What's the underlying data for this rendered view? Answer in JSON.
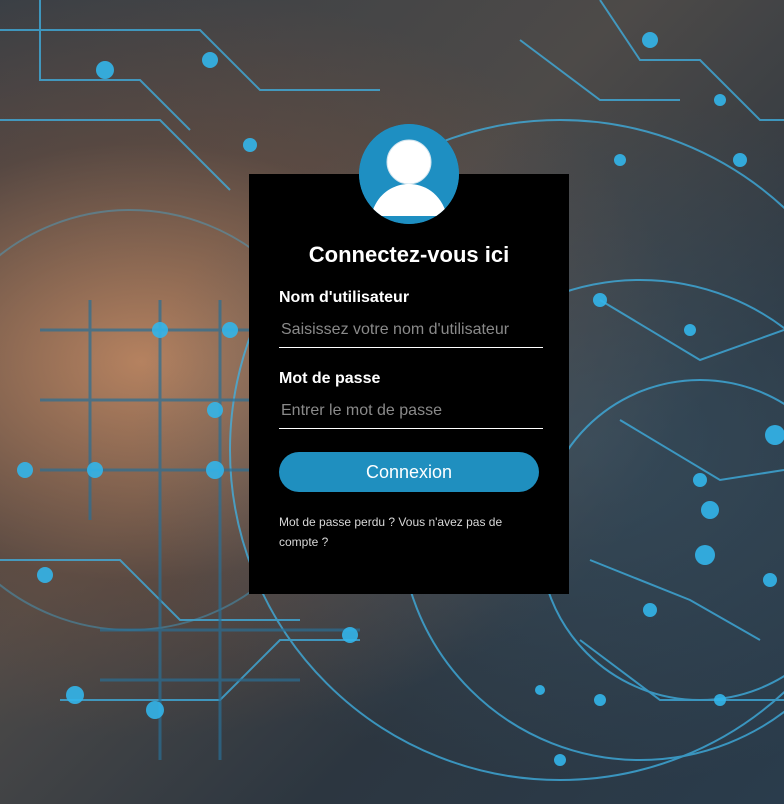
{
  "login": {
    "title": "Connectez-vous ici",
    "username_label": "Nom d'utilisateur",
    "username_placeholder": "Saisissez votre nom d'utilisateur",
    "password_label": "Mot de passe",
    "password_placeholder": "Entrer le mot de passe",
    "submit_label": "Connexion",
    "forgot_link": "Mot de passe perdu ?",
    "signup_link": "Vous n'avez pas de compte ?"
  },
  "theme": {
    "card_background": "#000000",
    "accent": "#1f8fbf",
    "avatar_icon": "user-avatar-icon",
    "background_image": "network-hand-photo"
  }
}
